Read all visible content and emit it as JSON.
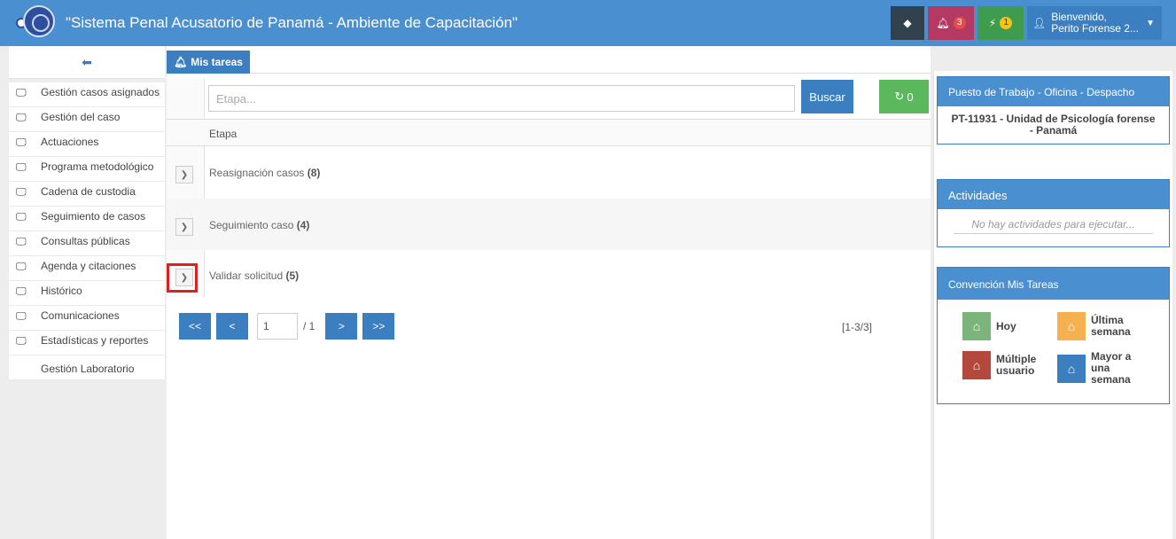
{
  "header": {
    "title": "\"Sistema Penal Acusatorio de Panamá - Ambiente de Capacitación\"",
    "notifications_count": "3",
    "alerts_count": "1",
    "user_greeting": "Bienvenido,",
    "user_name": "Perito Forense 2...",
    "icons": {
      "tag": "tag-icon",
      "bell": "bell-icon",
      "bolt": "bolt-icon",
      "user": "user-icon",
      "caret": "caret-down-icon"
    }
  },
  "sidebar": {
    "collapse_icon": "arrow-left-circle-icon",
    "items": [
      {
        "label": "Gestión casos asignados",
        "icon": "monitor-icon"
      },
      {
        "label": "Gestión del caso",
        "icon": "monitor-icon"
      },
      {
        "label": "Actuaciones",
        "icon": "monitor-icon"
      },
      {
        "label": "Programa metodológico",
        "icon": "monitor-icon"
      },
      {
        "label": "Cadena de custodia",
        "icon": "monitor-icon"
      },
      {
        "label": "Seguimiento de casos",
        "icon": "monitor-icon"
      },
      {
        "label": "Consultas públicas",
        "icon": "monitor-icon"
      },
      {
        "label": "Agenda y citaciones",
        "icon": "monitor-icon"
      },
      {
        "label": "Histórico",
        "icon": "monitor-icon"
      },
      {
        "label": "Comunicaciones",
        "icon": "monitor-icon"
      },
      {
        "label": "Estadísticas y reportes",
        "icon": "monitor-icon"
      },
      {
        "label": "Gestión Laboratorio",
        "icon": ""
      }
    ]
  },
  "main": {
    "tab_label": "Mis tareas",
    "search": {
      "placeholder": "Etapa...",
      "value": "",
      "button_label": "Buscar",
      "refresh_count": "0"
    },
    "table": {
      "header": "Etapa",
      "rows": [
        {
          "label": "Reasignación casos",
          "count": "(8)"
        },
        {
          "label": "Seguimiento caso",
          "count": "(4)"
        },
        {
          "label": "Validar solicitud",
          "count": "(5)"
        }
      ]
    },
    "pagination": {
      "first": "<<",
      "prev": "<",
      "current_page": "1",
      "total": "/ 1",
      "next": ">",
      "last": ">>",
      "range": "[1-3/3]"
    }
  },
  "right_panel": {
    "workstation": {
      "title": "Puesto de Trabajo - Oficina - Despacho",
      "value": "PT-11931 - Unidad de Psicología forense - Panamá"
    },
    "activities": {
      "title": "Actividades",
      "empty_text": "No hay actividades para ejecutar..."
    },
    "legend": {
      "title": "Convención Mis Tareas",
      "items": [
        {
          "label": "Hoy",
          "color": "#7bb57b"
        },
        {
          "label": "Última semana",
          "color": "#f5b14f"
        },
        {
          "label": "Múltiple usuario",
          "color": "#b5483c"
        },
        {
          "label": "Mayor a una semana",
          "color": "#3c7fc0"
        }
      ]
    }
  }
}
